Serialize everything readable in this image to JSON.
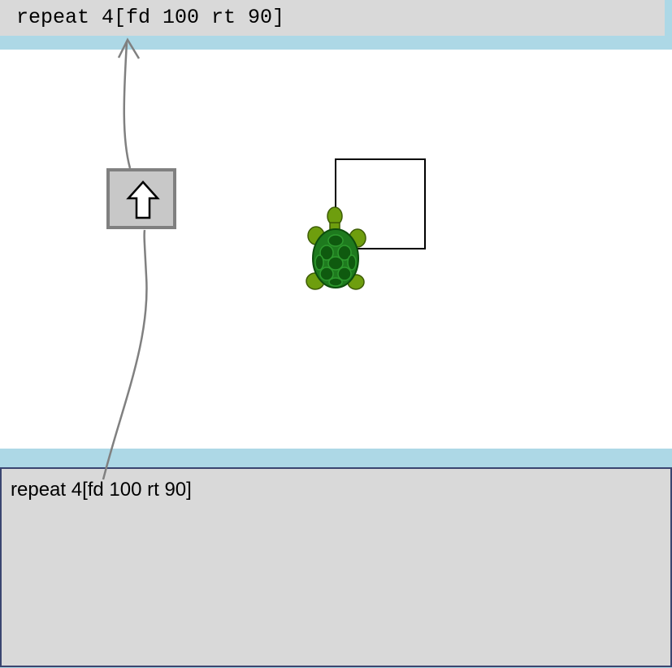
{
  "history": {
    "last_command": "repeat 4[fd 100 rt 90]"
  },
  "editor": {
    "code": "repeat 4[fd 100 rt 90]"
  },
  "run_button": {
    "icon": "up-arrow-icon"
  },
  "turtle": {
    "icon": "turtle-icon"
  },
  "colors": {
    "panel_bg": "#d9d9d9",
    "accent_bar": "#add8e6",
    "editor_border": "#3a4570",
    "button_bg": "#c8c8c8",
    "button_border": "#808080",
    "turtle_shell": "#1e7a1e",
    "turtle_skin": "#6e9e0e"
  }
}
